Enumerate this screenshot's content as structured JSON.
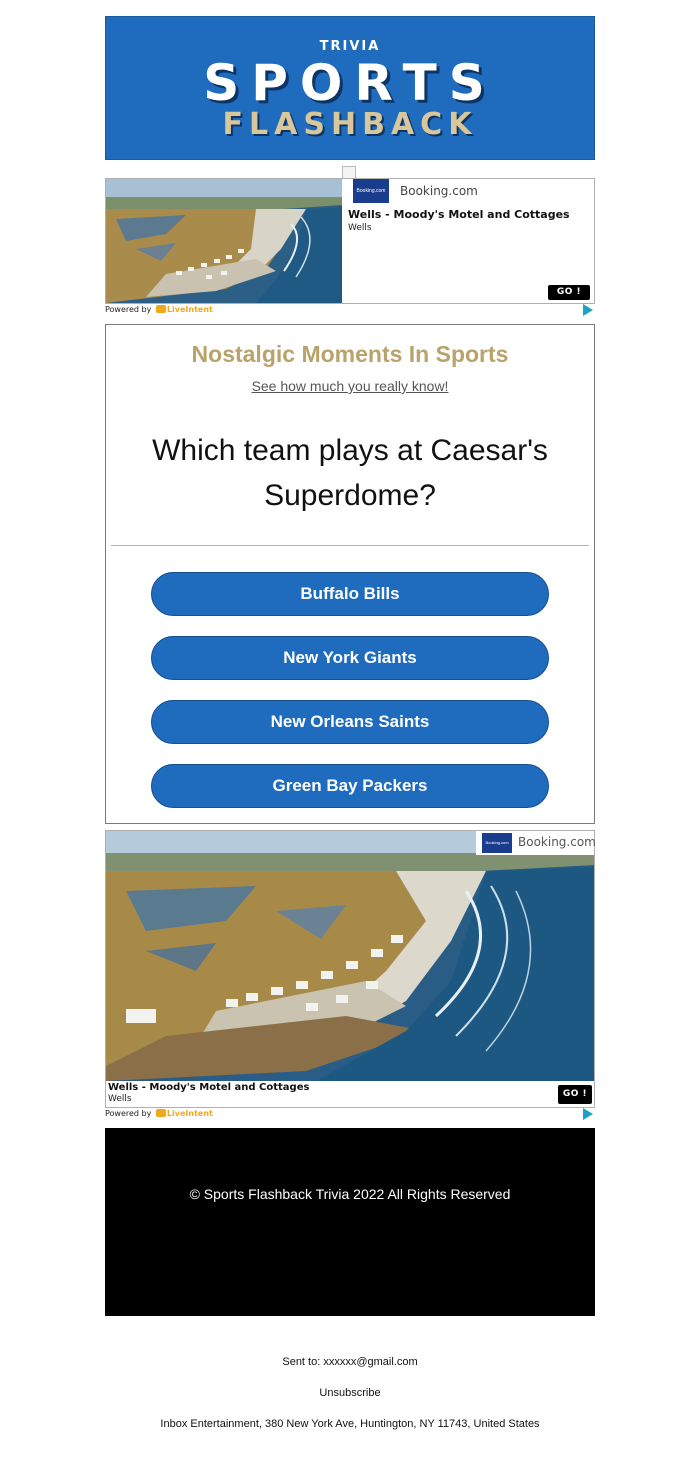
{
  "header": {
    "small_title": "TRIVIA",
    "title_line1": "SPORTS",
    "title_line2": "FLASHBACK"
  },
  "ad_top": {
    "brand_logo": "Booking.com",
    "brand": "Booking.com",
    "title": "Wells - Moody's Motel and Cottages",
    "location": "Wells",
    "cta": "GO !"
  },
  "powered": {
    "prefix": "Powered by",
    "name": "LiveIntent",
    "adchoices_icon": "adchoices-icon"
  },
  "quiz": {
    "heading": "Nostalgic Moments In Sports",
    "subheading_link": "See how much you really know!",
    "question": "Which team plays at Caesar's Superdome?",
    "answers": [
      "Buffalo Bills",
      "New York Giants",
      "New Orleans Saints",
      "Green Bay Packers"
    ]
  },
  "ad_bottom": {
    "brand_logo": "Booking.com",
    "brand": "Booking.com",
    "title": "Wells - Moody's Motel and Cottages",
    "location": "Wells",
    "cta": "GO !"
  },
  "footer": {
    "copyright": "© Sports Flashback Trivia 2022 All Rights Reserved"
  },
  "meta": {
    "sent_to_label": "Sent to:",
    "sent_to_email": "xxxxxx@gmail.com",
    "unsubscribe": "Unsubscribe",
    "address": "Inbox Entertainment, 380 New York Ave, Huntington, NY 11743, United States"
  },
  "colors": {
    "brand_blue": "#1f6bbd",
    "heading_gold": "#b9a36a",
    "liveintent_orange": "#f2a81d",
    "footer_black": "#000000"
  }
}
